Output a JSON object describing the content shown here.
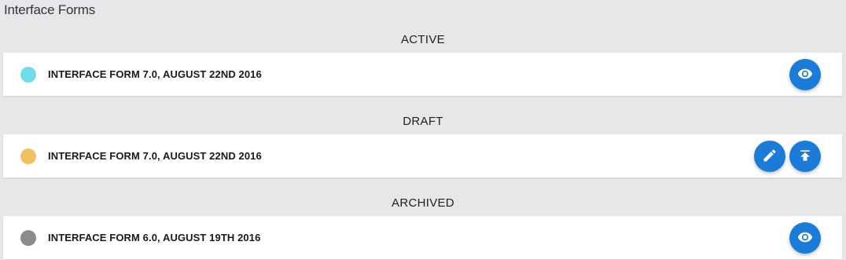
{
  "page": {
    "title": "Interface Forms"
  },
  "colors": {
    "active_dot": "#6ddde6",
    "draft_dot": "#f0c060",
    "archived_dot": "#8a8c8f",
    "button": "#1b7bd9"
  },
  "sections": {
    "active": {
      "heading": "ACTIVE",
      "form": {
        "name": "INTERFACE FORM 7.0, AUGUST 22ND 2016",
        "actions": [
          "view-icon"
        ]
      }
    },
    "draft": {
      "heading": "DRAFT",
      "form": {
        "name": "INTERFACE FORM 7.0, AUGUST 22ND 2016",
        "actions": [
          "edit-icon",
          "publish-icon"
        ]
      }
    },
    "archived": {
      "heading": "ARCHIVED",
      "form": {
        "name": "INTERFACE FORM 6.0, AUGUST 19TH 2016",
        "actions": [
          "view-icon"
        ]
      }
    }
  }
}
